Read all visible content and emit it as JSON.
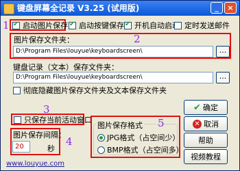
{
  "window": {
    "title": "键盘屏幕全记录 V3.25 (试用版)",
    "min_label": "_",
    "close_label": "×"
  },
  "annotations": {
    "n1": "1",
    "n2": "2",
    "n3": "3",
    "n4": "4",
    "n5": "5"
  },
  "options": {
    "start_img_save": "启动图片保存",
    "start_key_save": "启动按键保存",
    "auto_start": "开机自动启动",
    "timed_email": "定时发送邮件"
  },
  "image_folder": {
    "label": "图片保存文件夹：",
    "value": "D:\\Program Files\\louyue\\keyboardscreen\\"
  },
  "text_folder": {
    "label": "键盘记录（文本）保存文件夹：",
    "value": "D:\\Program Files\\louyue\\keyboardscreen\\"
  },
  "browse_label": "...",
  "hide_folders": "彻底隐藏图片保存文件夹及文本保存文件夹",
  "active_only": "只保存当前活动窗口",
  "interval": {
    "label": "图片保存间隔：",
    "value": "20",
    "unit": "秒"
  },
  "format": {
    "title": "图片保存格式",
    "jpg": "JPG格式（占空间少）",
    "bmp": "BMP格式（占空间多）",
    "selected": "jpg"
  },
  "buttons": {
    "ok": "确定",
    "cancel": "取消",
    "help": "帮助",
    "video": "视频教程"
  },
  "website": "www.louyue.com",
  "colors": {
    "annotation": "#8a2be2",
    "highlight": "#e01010"
  }
}
